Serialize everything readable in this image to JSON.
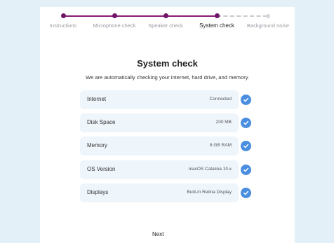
{
  "stepper": {
    "steps": [
      {
        "label": "Instructions"
      },
      {
        "label": "Microphone check"
      },
      {
        "label": "Speaker check"
      },
      {
        "label": "System check"
      },
      {
        "label": "Background noise"
      }
    ],
    "active_index": 3,
    "done_color": "#8a1a78",
    "todo_color": "#d6d6dc"
  },
  "main": {
    "title": "System check",
    "subtitle": "We are automatically checking your internet, hard drive, and memory."
  },
  "checks": [
    {
      "label": "Internet",
      "value": "Connected",
      "status": "check-icon"
    },
    {
      "label": "Disk Space",
      "value": "200 MB",
      "status": "check-icon"
    },
    {
      "label": "Memory",
      "value": "8 GB RAM",
      "status": "check-icon"
    },
    {
      "label": "OS Version",
      "value": "macOS Catalina 10.x",
      "status": "check-icon"
    },
    {
      "label": "Displays",
      "value": "Built-in Retina Display",
      "status": "check-icon"
    }
  ],
  "footer": {
    "next_label": "Next"
  },
  "colors": {
    "accent": "#4a8ee0",
    "row_bg": "#eef5fb",
    "page_bg": "#e3f0f8"
  }
}
